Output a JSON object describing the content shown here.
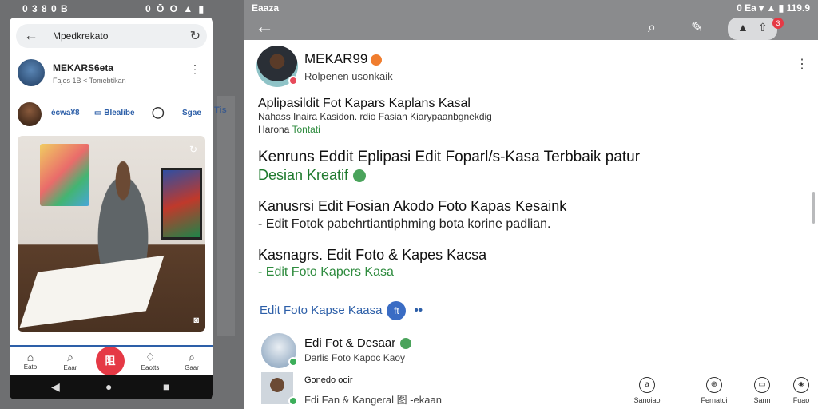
{
  "left": {
    "status": {
      "time": "0 3 8 0 B",
      "icons": "0 Ō O ▲ ▮"
    },
    "search": {
      "query": "Mpedkrekato"
    },
    "profile": {
      "name": "MEKARS6eta",
      "sub": "Fajes 1B < Tomebtikan"
    },
    "actions": [
      {
        "label": "ėcwa¥8"
      },
      {
        "label": "Blealibe"
      },
      {
        "label": "Sgae"
      }
    ],
    "nav": [
      {
        "label": "Eato"
      },
      {
        "label": "Eaar"
      },
      {
        "label": "Eaotts"
      },
      {
        "label": "Gaar"
      }
    ],
    "fab": "阻",
    "strip": "Tis"
  },
  "right": {
    "status": {
      "left": "Eaaza",
      "right": "0  Ea   ▾ ▲ ▮ 119.9"
    },
    "profile": {
      "name": "MEKAR99",
      "sub": "Rolpenen usonkaik"
    },
    "p1": {
      "title": "Aplipasildit Fot Kapars Kaplans Kasal",
      "line1": "Nahass Inaira Kasidon. rdio Fasian Kiarypaanbgnekdig",
      "line2a": "Harona",
      "line2b": "Tontati"
    },
    "p2": {
      "title": "Kenruns Eddit Eplipasi Edit Foparl/s-Kasa Terbbaik patur",
      "green": "Desian Kreatif"
    },
    "p3": {
      "title": "Kanusrsi Edit Fosian Akodo Foto Kapas Kesaink",
      "line": "- Edit Fotok pabehrtiantiphming bota korine padlian."
    },
    "p4": {
      "title": "Kasnagrs. Edit Foto & Kapes Kacsa",
      "line": "- Edit Foto Kapers Kasa"
    },
    "link": {
      "label": "Edit Foto Kapse Kaasa",
      "icon": "ft"
    },
    "items": [
      {
        "title": "Edi Fot & Desaar",
        "sub": "Darlis Foto Kapoc Kaoy"
      },
      {
        "title": "Gonedo ooir",
        "sub": "Fdi Fan & Kangeral 图 -ekaan"
      }
    ],
    "bottom": [
      {
        "label": "Sanoiao"
      },
      {
        "label": "Fernatoi"
      },
      {
        "label": "Sann"
      },
      {
        "label": "Fuao"
      }
    ],
    "badge": "3"
  }
}
